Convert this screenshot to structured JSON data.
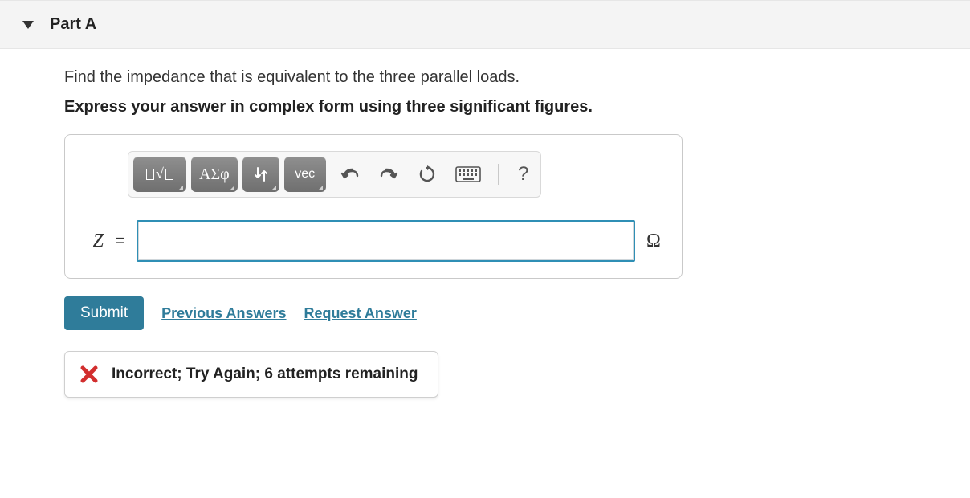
{
  "part": {
    "label": "Part A"
  },
  "question": "Find the impedance that is equivalent to the three parallel loads.",
  "instruction": "Express your answer in complex form using three significant figures.",
  "toolbar": {
    "tabs": {
      "templates_glyph": "√☐",
      "greek_glyph": "ΑΣφ",
      "subsup_glyph": "↓↑",
      "vec_glyph": "vec"
    }
  },
  "input": {
    "variable": "Z",
    "equals": "=",
    "value": "",
    "unit": "Ω"
  },
  "actions": {
    "submit": "Submit",
    "previous": "Previous Answers",
    "request": "Request Answer"
  },
  "feedback": {
    "message": "Incorrect; Try Again; 6 attempts remaining"
  }
}
